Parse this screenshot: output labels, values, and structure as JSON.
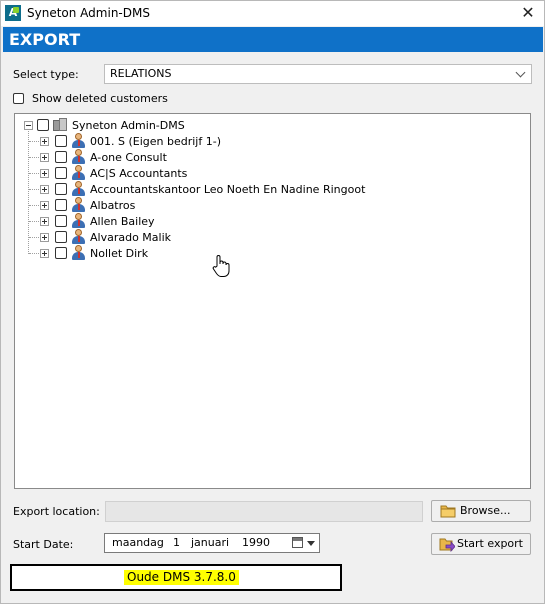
{
  "window": {
    "title": "Syneton Admin-DMS",
    "close": "✕"
  },
  "banner": {
    "title": "EXPORT"
  },
  "select_type": {
    "label": "Select type:",
    "value": "RELATIONS"
  },
  "show_deleted": {
    "label": "Show deleted customers",
    "checked": false
  },
  "tree": {
    "root": "Syneton Admin-DMS",
    "items": [
      "001. S (Eigen bedrijf 1-)",
      "A-one Consult",
      "AC|S Accountants",
      "Accountantskantoor Leo Noeth En Nadine Ringoot",
      "Albatros",
      "Allen Bailey",
      "Alvarado Malik",
      "Nollet Dirk"
    ]
  },
  "export_location": {
    "label": "Export location:",
    "value": ""
  },
  "browse_button": {
    "label": "Browse..."
  },
  "start_date": {
    "label": "Start Date:",
    "weekday": "maandag",
    "day": "1",
    "month": "januari",
    "year": "1990"
  },
  "start_export_button": {
    "label": "Start export"
  },
  "version": {
    "text": "Oude DMS 3.7.8.0"
  },
  "colors": {
    "banner": "#0f71c8",
    "highlight": "#ffff00",
    "window_bg": "#f0f0f0"
  }
}
